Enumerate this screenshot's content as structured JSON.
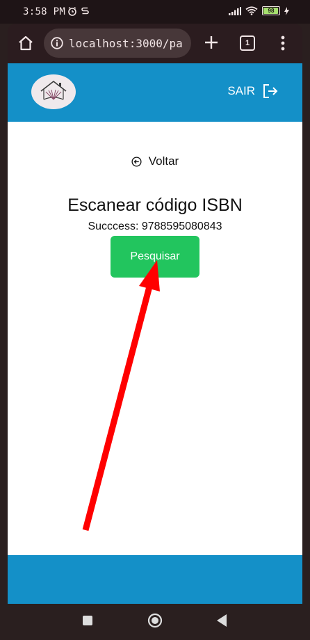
{
  "status_bar": {
    "time": "3:58 PM",
    "battery": "98"
  },
  "browser": {
    "url": "localhost:3000/pa",
    "tab_count": "1"
  },
  "header": {
    "logout_label": "SAIR"
  },
  "main": {
    "back_label": "Voltar",
    "title": "Escanear código ISBN",
    "status_text": "Succcess: 9788595080843",
    "search_button": "Pesquisar"
  },
  "colors": {
    "header_bg": "#1490c8",
    "button_bg": "#22c55e",
    "annotation_arrow": "#ff0000"
  }
}
